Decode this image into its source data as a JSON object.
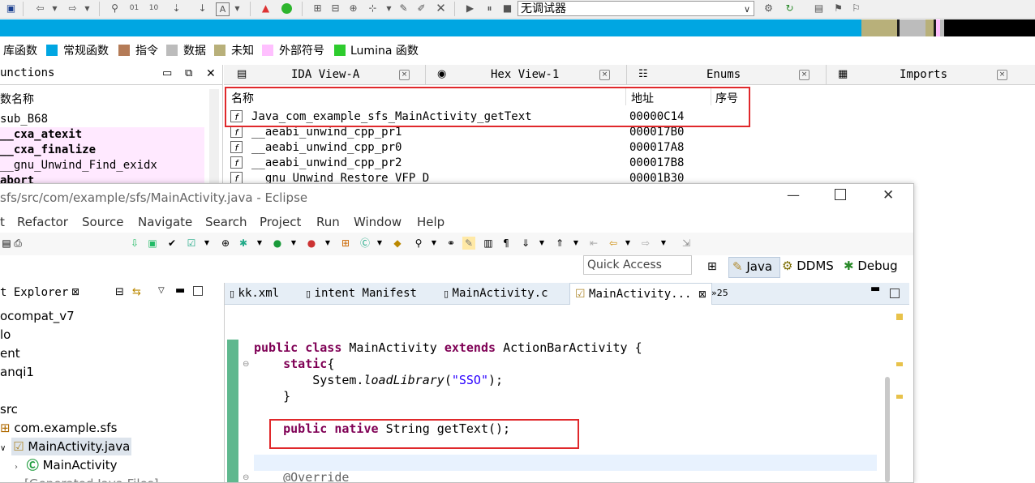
{
  "ida": {
    "debugger_select": "无调试器",
    "legend": [
      {
        "label": "库函数",
        "color": ""
      },
      {
        "label": "常规函数",
        "color": "#00a6e2"
      },
      {
        "label": "指令",
        "color": "#b47b57"
      },
      {
        "label": "数据",
        "color": "#bcbcbc"
      },
      {
        "label": "未知",
        "color": "#b8b07a"
      },
      {
        "label": "外部符号",
        "color": "#ffc0ff"
      },
      {
        "label": "Lumina 函数",
        "color": "#2ecc2e"
      }
    ],
    "functions_panel": {
      "title": "unctions",
      "column": "数名称",
      "rows": [
        {
          "name": "sub_B68",
          "style": "normal"
        },
        {
          "name": "__cxa_atexit",
          "style": "bold"
        },
        {
          "name": "__cxa_finalize",
          "style": "bold"
        },
        {
          "name": "__gnu_Unwind_Find_exidx",
          "style": "pink"
        },
        {
          "name": "abort",
          "style": "bold"
        }
      ]
    },
    "tabs": [
      {
        "label": "IDA View-A"
      },
      {
        "label": "Hex View-1"
      },
      {
        "label": "Enums"
      },
      {
        "label": "Imports"
      }
    ],
    "table": {
      "headers": [
        "名称",
        "地址",
        "序号"
      ],
      "rows": [
        {
          "name": "Java_com_example_sfs_MainActivity_getText",
          "address": "00000C14"
        },
        {
          "name": "__aeabi_unwind_cpp_pr1",
          "address": "000017B0"
        },
        {
          "name": "__aeabi_unwind_cpp_pr0",
          "address": "000017A8"
        },
        {
          "name": "__aeabi_unwind_cpp_pr2",
          "address": "000017B8"
        },
        {
          "name": "__gnu_Unwind_Restore_VFP_D",
          "address": "00001B30"
        }
      ]
    }
  },
  "eclipse": {
    "title": "sfs/src/com/example/sfs/MainActivity.java - Eclipse",
    "menu": [
      "t",
      "Refactor",
      "Source",
      "Navigate",
      "Search",
      "Project",
      "Run",
      "Window",
      "Help"
    ],
    "quick_access": "Quick Access",
    "perspectives": [
      "Java",
      "DDMS",
      "Debug"
    ],
    "package_explorer": {
      "title": "t Explorer",
      "items": [
        "ocompat_v7",
        "lo",
        "ent",
        "anqi1",
        "src",
        "com.example.sfs",
        "MainActivity.java",
        "MainActivity",
        "[Generated Java Files]"
      ]
    },
    "editor_tabs": [
      "kk.xml",
      "intent Manifest",
      "MainActivity.c",
      "MainActivity...",
      "25"
    ],
    "code": {
      "class_line": {
        "kw1": "public",
        "kw2": "class",
        "name": "MainActivity",
        "kw3": "extends",
        "parent": "ActionBarActivity {"
      },
      "static_line": {
        "kw": "static",
        "rest": "{"
      },
      "load_line": {
        "obj": "System.",
        "method": "loadLibrary",
        "open": "(",
        "str": "\"SSO\"",
        "close": ");"
      },
      "close_brace": "}",
      "native_line": {
        "kw1": "public",
        "kw2": "native",
        "rest": "String getText();"
      },
      "override": "@Override"
    }
  }
}
